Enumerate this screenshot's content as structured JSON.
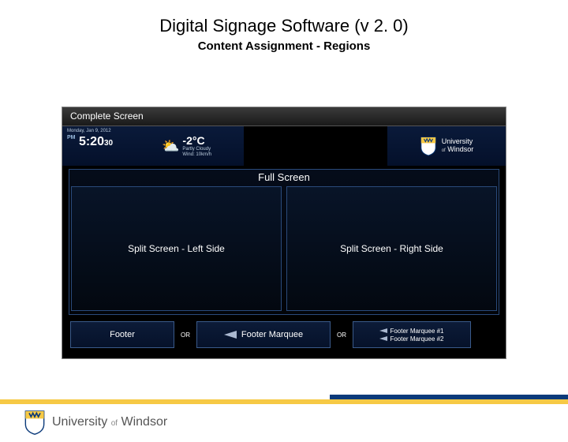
{
  "title": "Digital Signage Software (v 2. 0)",
  "subtitle": "Content Assignment - Regions",
  "screenshot": {
    "topbar_label": "Complete Screen",
    "clock": {
      "date": "Monday, Jan 9, 2012",
      "pm": "PM",
      "time_main": "5:20",
      "time_sec": "30"
    },
    "weather": {
      "temp": "-2°C",
      "cond": "Partly Cloudy",
      "wind": "Wind: 10km/h"
    },
    "university": {
      "line1": "University",
      "of": "of",
      "line2": "Windsor"
    },
    "regions": {
      "fullscreen": "Full Screen",
      "split_left": "Split Screen - Left Side",
      "split_right": "Split Screen - Right Side",
      "footer": "Footer",
      "or": "OR",
      "footer_marquee": "Footer Marquee",
      "footer_marquee_1": "Footer Marquee #1",
      "footer_marquee_2": "Footer Marquee #2"
    }
  },
  "footer_brand": {
    "university": "University",
    "of": "of",
    "windsor": "Windsor"
  }
}
